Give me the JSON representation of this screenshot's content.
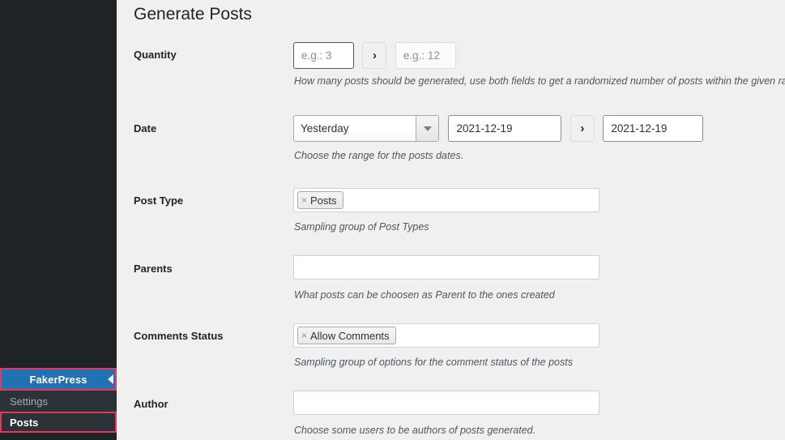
{
  "sidebar": {
    "menu_top": {
      "label": "FakerPress",
      "arrow_icon": "menu-arrow-icon"
    },
    "submenu": [
      {
        "label": "Settings",
        "current": false
      },
      {
        "label": "Posts",
        "current": true
      }
    ]
  },
  "page": {
    "title": "Generate Posts"
  },
  "form": {
    "rows": [
      {
        "label": "Quantity",
        "description": "How many posts should be generated, use both fields to get a randomized number of posts within the given rang",
        "min_placeholder": "e.g.: 3",
        "min_value": "",
        "max_placeholder": "e.g.: 12",
        "max_value": "",
        "separator_icon": "chevron-right-icon"
      },
      {
        "label": "Date",
        "description": "Choose the range for the posts dates.",
        "select_value": "Yesterday",
        "dropdown_icon": "chevron-down-icon",
        "start_date": "2021-12-19",
        "end_date": "2021-12-19",
        "separator_icon": "chevron-right-icon"
      },
      {
        "label": "Post Type",
        "description": "Sampling group of Post Types",
        "tokens": [
          {
            "remove_icon": "×",
            "label": "Posts"
          }
        ]
      },
      {
        "label": "Parents",
        "description": "What posts can be choosen as Parent to the ones created",
        "tokens": []
      },
      {
        "label": "Comments Status",
        "description": "Sampling group of options for the comment status of the posts",
        "tokens": [
          {
            "remove_icon": "×",
            "label": "Allow Comments"
          }
        ]
      },
      {
        "label": "Author",
        "description": "Choose some users to be authors of posts generated.",
        "tokens": []
      }
    ]
  },
  "colors": {
    "sidebar_bg": "#1d2327",
    "submenu_bg": "#2c3338",
    "menu_current_bg": "#2271b3",
    "highlight_outline": "#e8365a",
    "content_bg": "#f0f0f1"
  }
}
